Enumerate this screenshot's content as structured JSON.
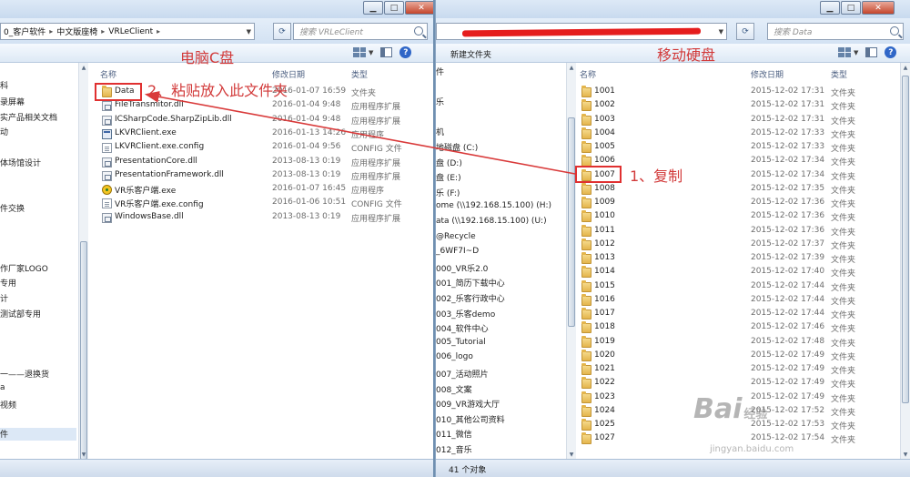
{
  "left_window": {
    "address": [
      "0_客户软件",
      "中文版座椅",
      "VRLeClient"
    ],
    "search_placeholder": "搜索 VRLeClient",
    "nav_items": [
      "科",
      "录屏幕",
      "实产品相关文档",
      "动",
      "体场馆设计",
      "",
      "件交换",
      "作厂家LOGO",
      "专用",
      "计",
      "测试部专用",
      "一——退换货",
      "a",
      "视频",
      "件"
    ],
    "columns": {
      "name": "名称",
      "date": "修改日期",
      "type": "类型"
    },
    "files": [
      {
        "name": "Data",
        "date": "2016-01-07 16:59",
        "type": "文件夹",
        "icon": "folder-icon"
      },
      {
        "name": "FileTransmitor.dll",
        "date": "2016-01-04 9:48",
        "type": "应用程序扩展",
        "icon": "dll-icon"
      },
      {
        "name": "ICSharpCode.SharpZipLib.dll",
        "date": "2016-01-04 9:48",
        "type": "应用程序扩展",
        "icon": "dll-icon"
      },
      {
        "name": "LKVRClient.exe",
        "date": "2016-01-13 14:26",
        "type": "应用程序",
        "icon": "exe-icon"
      },
      {
        "name": "LKVRClient.exe.config",
        "date": "2016-01-04 9:56",
        "type": "CONFIG 文件",
        "icon": "config-file-icon"
      },
      {
        "name": "PresentationCore.dll",
        "date": "2013-08-13 0:19",
        "type": "应用程序扩展",
        "icon": "dll-icon"
      },
      {
        "name": "PresentationFramework.dll",
        "date": "2013-08-13 0:19",
        "type": "应用程序扩展",
        "icon": "dll-icon"
      },
      {
        "name": "VR乐客户端.exe",
        "date": "2016-01-07 16:45",
        "type": "应用程序",
        "icon": "vr-app-icon"
      },
      {
        "name": "VR乐客户端.exe.config",
        "date": "2016-01-06 10:51",
        "type": "CONFIG 文件",
        "icon": "config-file-icon"
      },
      {
        "name": "WindowsBase.dll",
        "date": "2013-08-13 0:19",
        "type": "应用程序扩展",
        "icon": "dll-icon"
      }
    ]
  },
  "right_window": {
    "search_placeholder": "搜索 Data",
    "toolbar_label": "新建文件夹",
    "nav_items": [
      "件",
      "",
      "乐",
      "",
      "机",
      "地磁盘 (C:)",
      "盘 (D:)",
      "盘 (E:)",
      "乐 (F:)",
      "ome (\\\\192.168.15.100) (H:)",
      "ata (\\\\192.168.15.100) (U:)",
      "@Recycle",
      "_6WF7I~D",
      "000_VR乐2.0",
      "001_简历下载中心",
      "002_乐客行政中心",
      "003_乐客demo",
      "004_软件中心",
      "005_Tutorial",
      "006_logo",
      "007_活动照片",
      "008_文案",
      "009_VR游戏大厅",
      "010_其他公司资料",
      "011_微信",
      "012_音乐"
    ],
    "columns": {
      "name": "名称",
      "date": "修改日期",
      "type": "类型"
    },
    "status": "41 个对象",
    "folders": [
      {
        "name": "1001",
        "date": "2015-12-02 17:31",
        "type": "文件夹"
      },
      {
        "name": "1002",
        "date": "2015-12-02 17:31",
        "type": "文件夹"
      },
      {
        "name": "1003",
        "date": "2015-12-02 17:31",
        "type": "文件夹"
      },
      {
        "name": "1004",
        "date": "2015-12-02 17:33",
        "type": "文件夹"
      },
      {
        "name": "1005",
        "date": "2015-12-02 17:33",
        "type": "文件夹"
      },
      {
        "name": "1006",
        "date": "2015-12-02 17:34",
        "type": "文件夹"
      },
      {
        "name": "1007",
        "date": "2015-12-02 17:34",
        "type": "文件夹"
      },
      {
        "name": "1008",
        "date": "2015-12-02 17:35",
        "type": "文件夹"
      },
      {
        "name": "1009",
        "date": "2015-12-02 17:36",
        "type": "文件夹"
      },
      {
        "name": "1010",
        "date": "2015-12-02 17:36",
        "type": "文件夹"
      },
      {
        "name": "1011",
        "date": "2015-12-02 17:36",
        "type": "文件夹"
      },
      {
        "name": "1012",
        "date": "2015-12-02 17:37",
        "type": "文件夹"
      },
      {
        "name": "1013",
        "date": "2015-12-02 17:39",
        "type": "文件夹"
      },
      {
        "name": "1014",
        "date": "2015-12-02 17:40",
        "type": "文件夹"
      },
      {
        "name": "1015",
        "date": "2015-12-02 17:44",
        "type": "文件夹"
      },
      {
        "name": "1016",
        "date": "2015-12-02 17:44",
        "type": "文件夹"
      },
      {
        "name": "1017",
        "date": "2015-12-02 17:44",
        "type": "文件夹"
      },
      {
        "name": "1018",
        "date": "2015-12-02 17:46",
        "type": "文件夹"
      },
      {
        "name": "1019",
        "date": "2015-12-02 17:48",
        "type": "文件夹"
      },
      {
        "name": "1020",
        "date": "2015-12-02 17:49",
        "type": "文件夹"
      },
      {
        "name": "1021",
        "date": "2015-12-02 17:49",
        "type": "文件夹"
      },
      {
        "name": "1022",
        "date": "2015-12-02 17:49",
        "type": "文件夹"
      },
      {
        "name": "1023",
        "date": "2015-12-02 17:49",
        "type": "文件夹"
      },
      {
        "name": "1024",
        "date": "2015-12-02 17:52",
        "type": "文件夹"
      },
      {
        "name": "1025",
        "date": "2015-12-02 17:53",
        "type": "文件夹"
      },
      {
        "name": "1027",
        "date": "2015-12-02 17:54",
        "type": "文件夹"
      }
    ]
  },
  "annotations": {
    "left_title": "电脑C盘",
    "right_title": "移动硬盘",
    "step2": "2、粘贴放入此文件夹",
    "step1": "1、复制",
    "arrow_color": "#d93a3a"
  },
  "watermark": {
    "brand": "Bai",
    "brand_cn": "经验",
    "url": "jingyan.baidu.com"
  }
}
